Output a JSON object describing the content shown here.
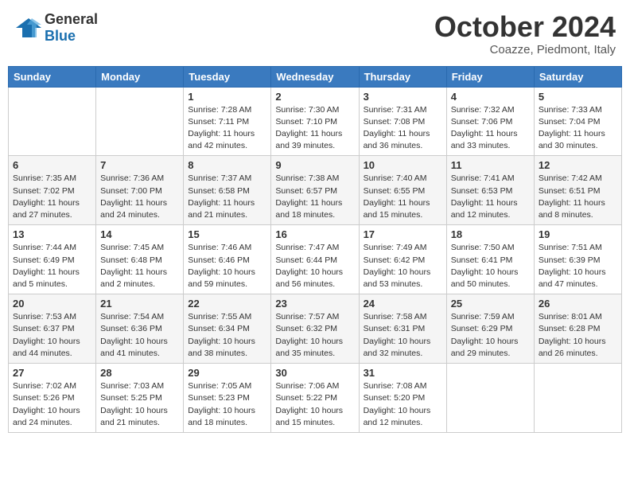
{
  "header": {
    "logo_general": "General",
    "logo_blue": "Blue",
    "month_title": "October 2024",
    "subtitle": "Coazze, Piedmont, Italy"
  },
  "days_of_week": [
    "Sunday",
    "Monday",
    "Tuesday",
    "Wednesday",
    "Thursday",
    "Friday",
    "Saturday"
  ],
  "weeks": [
    [
      {
        "day": "",
        "info": ""
      },
      {
        "day": "",
        "info": ""
      },
      {
        "day": "1",
        "info": "Sunrise: 7:28 AM\nSunset: 7:11 PM\nDaylight: 11 hours and 42 minutes."
      },
      {
        "day": "2",
        "info": "Sunrise: 7:30 AM\nSunset: 7:10 PM\nDaylight: 11 hours and 39 minutes."
      },
      {
        "day": "3",
        "info": "Sunrise: 7:31 AM\nSunset: 7:08 PM\nDaylight: 11 hours and 36 minutes."
      },
      {
        "day": "4",
        "info": "Sunrise: 7:32 AM\nSunset: 7:06 PM\nDaylight: 11 hours and 33 minutes."
      },
      {
        "day": "5",
        "info": "Sunrise: 7:33 AM\nSunset: 7:04 PM\nDaylight: 11 hours and 30 minutes."
      }
    ],
    [
      {
        "day": "6",
        "info": "Sunrise: 7:35 AM\nSunset: 7:02 PM\nDaylight: 11 hours and 27 minutes."
      },
      {
        "day": "7",
        "info": "Sunrise: 7:36 AM\nSunset: 7:00 PM\nDaylight: 11 hours and 24 minutes."
      },
      {
        "day": "8",
        "info": "Sunrise: 7:37 AM\nSunset: 6:58 PM\nDaylight: 11 hours and 21 minutes."
      },
      {
        "day": "9",
        "info": "Sunrise: 7:38 AM\nSunset: 6:57 PM\nDaylight: 11 hours and 18 minutes."
      },
      {
        "day": "10",
        "info": "Sunrise: 7:40 AM\nSunset: 6:55 PM\nDaylight: 11 hours and 15 minutes."
      },
      {
        "day": "11",
        "info": "Sunrise: 7:41 AM\nSunset: 6:53 PM\nDaylight: 11 hours and 12 minutes."
      },
      {
        "day": "12",
        "info": "Sunrise: 7:42 AM\nSunset: 6:51 PM\nDaylight: 11 hours and 8 minutes."
      }
    ],
    [
      {
        "day": "13",
        "info": "Sunrise: 7:44 AM\nSunset: 6:49 PM\nDaylight: 11 hours and 5 minutes."
      },
      {
        "day": "14",
        "info": "Sunrise: 7:45 AM\nSunset: 6:48 PM\nDaylight: 11 hours and 2 minutes."
      },
      {
        "day": "15",
        "info": "Sunrise: 7:46 AM\nSunset: 6:46 PM\nDaylight: 10 hours and 59 minutes."
      },
      {
        "day": "16",
        "info": "Sunrise: 7:47 AM\nSunset: 6:44 PM\nDaylight: 10 hours and 56 minutes."
      },
      {
        "day": "17",
        "info": "Sunrise: 7:49 AM\nSunset: 6:42 PM\nDaylight: 10 hours and 53 minutes."
      },
      {
        "day": "18",
        "info": "Sunrise: 7:50 AM\nSunset: 6:41 PM\nDaylight: 10 hours and 50 minutes."
      },
      {
        "day": "19",
        "info": "Sunrise: 7:51 AM\nSunset: 6:39 PM\nDaylight: 10 hours and 47 minutes."
      }
    ],
    [
      {
        "day": "20",
        "info": "Sunrise: 7:53 AM\nSunset: 6:37 PM\nDaylight: 10 hours and 44 minutes."
      },
      {
        "day": "21",
        "info": "Sunrise: 7:54 AM\nSunset: 6:36 PM\nDaylight: 10 hours and 41 minutes."
      },
      {
        "day": "22",
        "info": "Sunrise: 7:55 AM\nSunset: 6:34 PM\nDaylight: 10 hours and 38 minutes."
      },
      {
        "day": "23",
        "info": "Sunrise: 7:57 AM\nSunset: 6:32 PM\nDaylight: 10 hours and 35 minutes."
      },
      {
        "day": "24",
        "info": "Sunrise: 7:58 AM\nSunset: 6:31 PM\nDaylight: 10 hours and 32 minutes."
      },
      {
        "day": "25",
        "info": "Sunrise: 7:59 AM\nSunset: 6:29 PM\nDaylight: 10 hours and 29 minutes."
      },
      {
        "day": "26",
        "info": "Sunrise: 8:01 AM\nSunset: 6:28 PM\nDaylight: 10 hours and 26 minutes."
      }
    ],
    [
      {
        "day": "27",
        "info": "Sunrise: 7:02 AM\nSunset: 5:26 PM\nDaylight: 10 hours and 24 minutes."
      },
      {
        "day": "28",
        "info": "Sunrise: 7:03 AM\nSunset: 5:25 PM\nDaylight: 10 hours and 21 minutes."
      },
      {
        "day": "29",
        "info": "Sunrise: 7:05 AM\nSunset: 5:23 PM\nDaylight: 10 hours and 18 minutes."
      },
      {
        "day": "30",
        "info": "Sunrise: 7:06 AM\nSunset: 5:22 PM\nDaylight: 10 hours and 15 minutes."
      },
      {
        "day": "31",
        "info": "Sunrise: 7:08 AM\nSunset: 5:20 PM\nDaylight: 10 hours and 12 minutes."
      },
      {
        "day": "",
        "info": ""
      },
      {
        "day": "",
        "info": ""
      }
    ]
  ]
}
